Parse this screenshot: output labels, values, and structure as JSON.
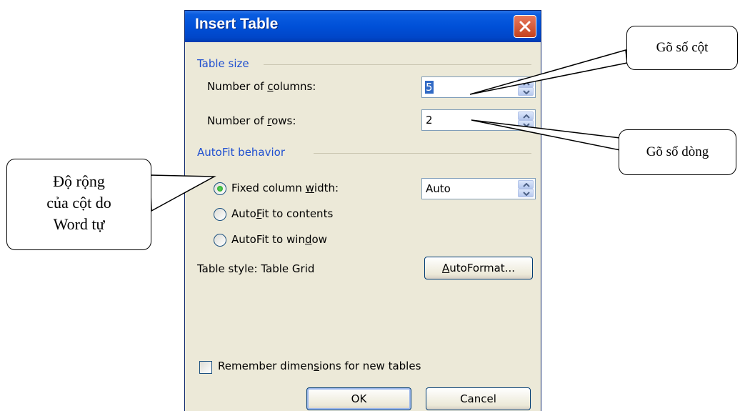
{
  "dialog": {
    "title": "Insert Table",
    "close_icon": "close-icon",
    "table_size": {
      "group_label": "Table size",
      "columns_label_pre": "Number of ",
      "columns_label_accel": "c",
      "columns_label_post": "olumns:",
      "columns_value": "5",
      "rows_label_pre": "Number of ",
      "rows_label_accel": "r",
      "rows_label_post": "ows:",
      "rows_value": "2"
    },
    "autofit": {
      "group_label": "AutoFit behavior",
      "fixed_pre": "Fixed column ",
      "fixed_accel": "w",
      "fixed_post": "idth:",
      "fixed_value": "Auto",
      "contents_pre": "Auto",
      "contents_accel": "F",
      "contents_post": "it to contents",
      "window_pre": "AutoFit to win",
      "window_accel": "d",
      "window_post": "ow",
      "selected": "fixed"
    },
    "table_style": {
      "label": "Table style:  Table Grid",
      "autoformat_accel": "A",
      "autoformat_post": "utoFormat..."
    },
    "remember": {
      "pre": "Remember dimen",
      "accel": "s",
      "post": "ions for new tables",
      "checked": false
    },
    "buttons": {
      "ok": "OK",
      "cancel": "Cancel"
    }
  },
  "callouts": {
    "columns": "Gõ số cột",
    "rows": "Gõ số dòng",
    "width_line1": "Độ rộng",
    "width_line2": "của cột do",
    "width_line3": "Word tự"
  },
  "colors": {
    "title_bar": "#0050d8",
    "dialog_bg": "#ece9d8",
    "group_label": "#1f4fd0",
    "selection": "#316ac5",
    "close_button": "#d9572f"
  }
}
